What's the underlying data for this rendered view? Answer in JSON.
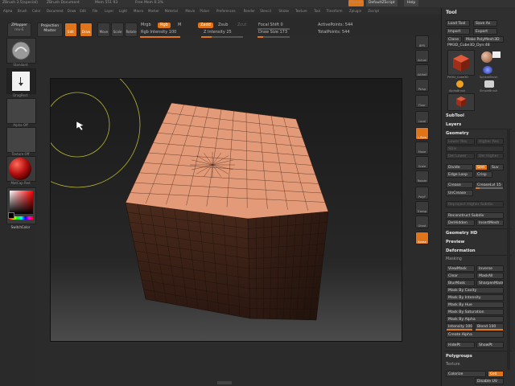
{
  "title_bar": {
    "app_title": "ZBrush 3.5(special)",
    "document": "ZBrush Document",
    "mem": "Mem 551 93",
    "free_mem": "Free Mem 0.3%",
    "menus": [
      "Alpha",
      "Brush",
      "Color",
      "Document",
      "Draw",
      "Edit",
      "File",
      "Layer",
      "Light",
      "Macro",
      "Marker",
      "Material",
      "Movie",
      "Picker",
      "Preferences",
      "Render",
      "Stencil",
      "Stroke",
      "Texture",
      "Tool",
      "Transform",
      "Zplugin",
      "Zscript"
    ],
    "menu_button": "Menus",
    "default_script": "DefaultZScript",
    "help": "Help"
  },
  "top_shelf": {
    "zmapper": "ZMapper",
    "zmapper_sub": "rev-E",
    "projection_master": "Projection Master",
    "buttons": [
      "Edit",
      "Draw",
      "Move",
      "Scale",
      "Rotate"
    ],
    "mrgb": "Mrgb",
    "rgb": "Rgb",
    "m": "M",
    "rgb_intensity": "Rgb Intensity 100",
    "zadd": "Zadd",
    "zsub": "Zsub",
    "zcut": "Zcut",
    "z_intensity": "Z Intensity 25",
    "focal_shift": "Focal Shift 0",
    "draw_size": "Draw Size 173",
    "active_points": "ActivePoints: 544",
    "total_points": "TotalPoints: 544",
    "rgb_intensity_level": 1.0,
    "z_intensity_level": 0.25,
    "draw_size_level": 0.17
  },
  "left_tray": {
    "brush_label": "Standard",
    "stroke_label": "DragRect",
    "alpha_label": "Alpha Off",
    "texture_label": "Texture Off",
    "material_label": "MatCap Red",
    "switch_color": "SwitchColor"
  },
  "right_shelf": [
    "BPR",
    "Actual",
    "AAHalf",
    "Persp",
    "Floor",
    "Local",
    "L.Sym",
    "Move",
    "Scale",
    "Rotate",
    "PolyF",
    "Transp",
    "Ghost",
    "Xpose"
  ],
  "tool_palette": {
    "header": "Tool",
    "load_tool": "Load Tool",
    "save_as": "Save As",
    "import": "Import",
    "export": "Export",
    "clone": "Clone",
    "make_polymesh": "Make PolyMesh3D",
    "current_tool": "PM3D_Cube3D_Dyn:48",
    "tools": [
      "PM3D_Cube3D",
      "SphereBrush",
      "AlphaBrush",
      "SimpleBrush",
      "EraserBrush",
      "PM3D_Cube3D"
    ],
    "subtool": "SubTool",
    "layers": "Layers",
    "geometry": "Geometry",
    "lower_res": "Lower Res",
    "higher_res": "Higher Res",
    "sdiv": "SDiv",
    "del_lower": "Del Lower",
    "del_higher": "Del Higher",
    "divide": "Divide",
    "smt": "Smt",
    "suv": "Suv",
    "edge_loop": "Edge Loop",
    "crisp": "Crisp",
    "crease": "Crease",
    "crease_lvl": "CreaseLvl 15",
    "uncrease": "UnCrease",
    "reproject_higher_subdiv": "Reproject Higher Subdiv",
    "reconstruct_subdiv": "Reconstruct Subdiv",
    "del_hidden": "DelHidden",
    "insert_mesh": "InsertMesh",
    "geometry_hd": "Geometry HD",
    "preview": "Preview",
    "deformation": "Deformation",
    "masking": "Masking",
    "view_mask": "ViewMask",
    "inverse": "Inverse",
    "clear": "Clear",
    "mask_all": "MaskAll",
    "blur_mask": "BlurMask",
    "sharpen_mask": "SharpenMask",
    "mask_by_cavity": "Mask By Cavity",
    "mask_by_intensity": "Mask By Intensity",
    "mask_by_hue": "Mask By Hue",
    "mask_by_saturation": "Mask By Saturation",
    "mask_by_alpha": "Mask By Alpha",
    "intensity": "Intensity 100",
    "blend": "Blend 100",
    "create_alpha": "Create Alpha",
    "hide_pt": "HidePt",
    "show_pt": "ShowPt",
    "polygroups": "Polygroups",
    "texture": "Texture",
    "colorize": "Colorize",
    "grd": "Grd",
    "disable_uv": "Disable UV",
    "intensity_level": 1.0,
    "blend_level": 1.0,
    "crease_level": 0.15
  },
  "colors": {
    "accent": "#e07418",
    "cube": "#e29a78",
    "cube_side": "#3a2016",
    "background": "#2b2b2b"
  }
}
